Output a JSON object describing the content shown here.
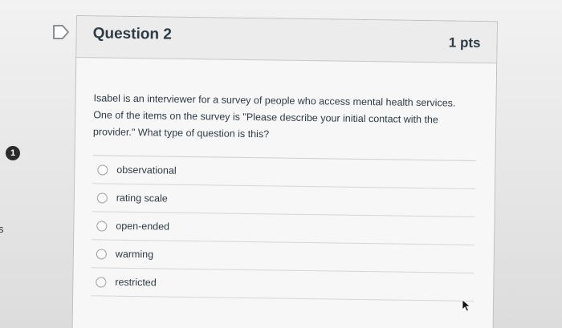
{
  "question": {
    "title": "Question 2",
    "points": "1 pts",
    "text": "Isabel is an interviewer for a survey of people who access mental health services. One of the items on the survey is \"Please describe your initial contact with the provider.\" What type of question is this?",
    "answers": [
      {
        "label": "observational"
      },
      {
        "label": "rating scale"
      },
      {
        "label": "open-ended"
      },
      {
        "label": "warming"
      },
      {
        "label": "restricted"
      }
    ]
  },
  "sidebar": {
    "badge": "1",
    "edge_letter": "s"
  },
  "icons": {
    "flag": "flag-icon",
    "cursor": "mouse-pointer-icon"
  },
  "colors": {
    "text": "#2d3b45",
    "header_bg": "#ececec",
    "card_bg": "#f7f7f7"
  }
}
